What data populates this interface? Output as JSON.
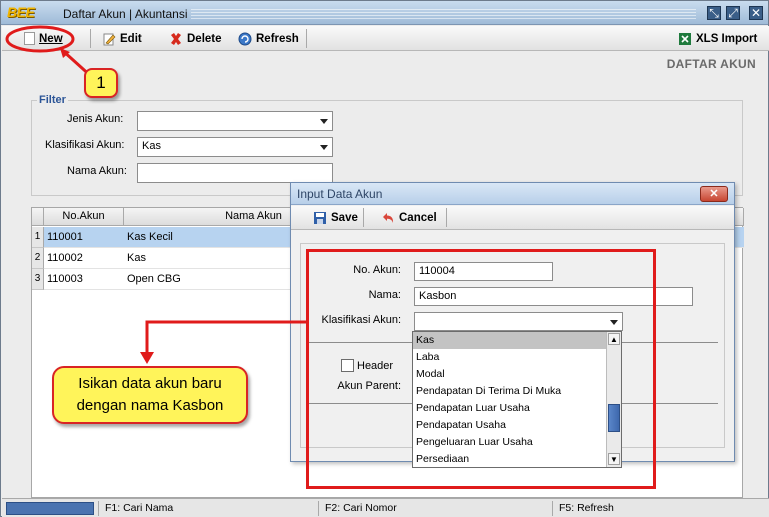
{
  "window": {
    "app_logo": "BEE",
    "title": "Daftar Akun | Akuntansi",
    "controls": [
      "⤡",
      "⤢",
      "✕"
    ]
  },
  "toolbar": {
    "new_label": "New",
    "edit_label": "Edit",
    "delete_label": "Delete",
    "refresh_label": "Refresh",
    "xls_label": "XLS Import"
  },
  "page_heading": "DAFTAR AKUN",
  "filter": {
    "legend": "Filter",
    "jenis_label": "Jenis Akun:",
    "jenis_value": "",
    "klasifikasi_label": "Klasifikasi Akun:",
    "klasifikasi_value": "Kas",
    "nama_label": "Nama Akun:",
    "nama_value": ""
  },
  "grid": {
    "columns": [
      "No.Akun",
      "Nama Akun"
    ],
    "rows": [
      {
        "num": "1",
        "no": "110001",
        "nama": "Kas Kecil"
      },
      {
        "num": "2",
        "no": "110002",
        "nama": "Kas"
      },
      {
        "num": "3",
        "no": "110003",
        "nama": "Open CBG"
      }
    ]
  },
  "statusbar": {
    "f1": "F1: Cari Nama",
    "f2": "F2: Cari Nomor",
    "f5": "F5: Refresh"
  },
  "dialog": {
    "title": "Input Data Akun",
    "close": "✕",
    "save_label": "Save",
    "cancel_label": "Cancel",
    "no_akun_label": "No. Akun:",
    "no_akun_value": "110004",
    "nama_label": "Nama:",
    "nama_value": "Kasbon",
    "klasifikasi_label": "Klasifikasi Akun:",
    "klasifikasi_value": "",
    "header_label": "Header",
    "akun_parent_label": "Akun Parent:"
  },
  "dropdown": {
    "options": [
      "Kas",
      "Laba",
      "Modal",
      "Pendapatan Di Terima Di Muka",
      "Pendapatan Luar Usaha",
      "Pendapatan Usaha",
      "Pengeluaran Luar Usaha",
      "Persediaan"
    ],
    "highlighted_index": 0
  },
  "annotations": {
    "badge_number": "1",
    "callout_text_line1": "Isikan data akun baru",
    "callout_text_line2": "dengan nama Kasbon",
    "color": "#e01b1b"
  }
}
